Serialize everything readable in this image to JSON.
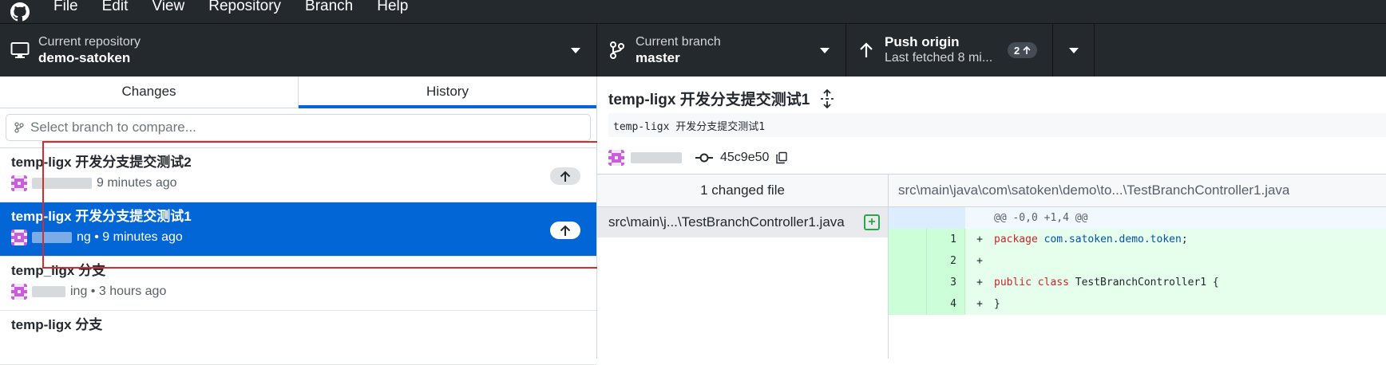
{
  "menu": {
    "items": [
      "File",
      "Edit",
      "View",
      "Repository",
      "Branch",
      "Help"
    ]
  },
  "toolbar": {
    "repo": {
      "label": "Current repository",
      "value": "demo-satoken"
    },
    "branch": {
      "label": "Current branch",
      "value": "master"
    },
    "push": {
      "title": "Push origin",
      "subtitle": "Last fetched 8 mi...",
      "count": "2"
    }
  },
  "tabs": {
    "changes": "Changes",
    "history": "History"
  },
  "filter": {
    "placeholder": "Select branch to compare..."
  },
  "commits": [
    {
      "title": "temp-ligx 开发分支提交测试2",
      "meta": "9 minutes ago",
      "author_suffix": ""
    },
    {
      "title": "temp-ligx 开发分支提交测试1",
      "meta": "ng • 9 minutes ago",
      "author_suffix": ""
    },
    {
      "title": "temp_ligx 分支",
      "meta": "ing • 3 hours ago",
      "author_suffix": ""
    },
    {
      "title": "temp-ligx 分支",
      "meta": "",
      "author_suffix": ""
    }
  ],
  "detail": {
    "title": "temp-ligx 开发分支提交测试1",
    "body": "temp-ligx 开发分支提交测试1",
    "sha": "45c9e50",
    "changed_files": "1 changed file",
    "file_path_header": "src\\main\\java\\com\\satoken\\demo\\to...\\TestBranchController1.java",
    "file_row": "src\\main\\j...\\TestBranchController1.java",
    "hunk": "@@ -0,0 +1,4 @@",
    "lines": [
      {
        "num": "1",
        "sign": "+",
        "kw": "package",
        "rest": " ",
        "pk": "com.satoken.demo.token",
        "end": ";"
      },
      {
        "num": "2",
        "sign": "+",
        "kw": "",
        "rest": "",
        "pk": "",
        "end": ""
      },
      {
        "num": "3",
        "sign": "+",
        "kw": "public class",
        "rest": " TestBranchController1 {",
        "pk": "",
        "end": ""
      },
      {
        "num": "4",
        "sign": "+",
        "kw": "",
        "rest": "}",
        "pk": "",
        "end": ""
      }
    ]
  },
  "colors": {
    "accent": "#0366d6",
    "toolbar_bg": "#24292e",
    "highlight_box": "#d92b2b",
    "added": "#28a745"
  }
}
